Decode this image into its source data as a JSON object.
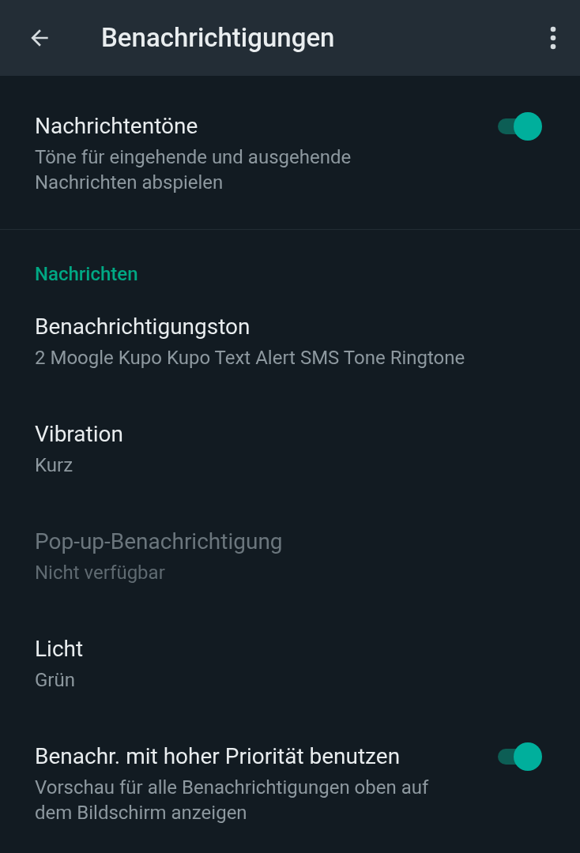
{
  "app_bar": {
    "title": "Benachrichtigungen"
  },
  "sections": [
    {
      "items": [
        {
          "kind": "toggle",
          "title": "Nachrichtentöne",
          "subtitle": "Töne für eingehende und ausgehende Nachrichten abspielen",
          "on": true,
          "disabled": false
        }
      ]
    },
    {
      "header": "Nachrichten",
      "items": [
        {
          "kind": "option",
          "title": "Benachrichtigungston",
          "subtitle": "2 Moogle Kupo Kupo Text Alert SMS Tone Ringtone",
          "disabled": false
        },
        {
          "kind": "option",
          "title": "Vibration",
          "subtitle": "Kurz",
          "disabled": false
        },
        {
          "kind": "option",
          "title": "Pop-up-Benachrichtigung",
          "subtitle": "Nicht verfügbar",
          "disabled": true
        },
        {
          "kind": "option",
          "title": "Licht",
          "subtitle": "Grün",
          "disabled": false
        },
        {
          "kind": "toggle",
          "title": "Benachr. mit hoher Priorität benutzen",
          "subtitle": "Vorschau für alle Benachrichtigungen oben auf dem Bildschirm anzeigen",
          "on": true,
          "disabled": false
        }
      ]
    }
  ]
}
